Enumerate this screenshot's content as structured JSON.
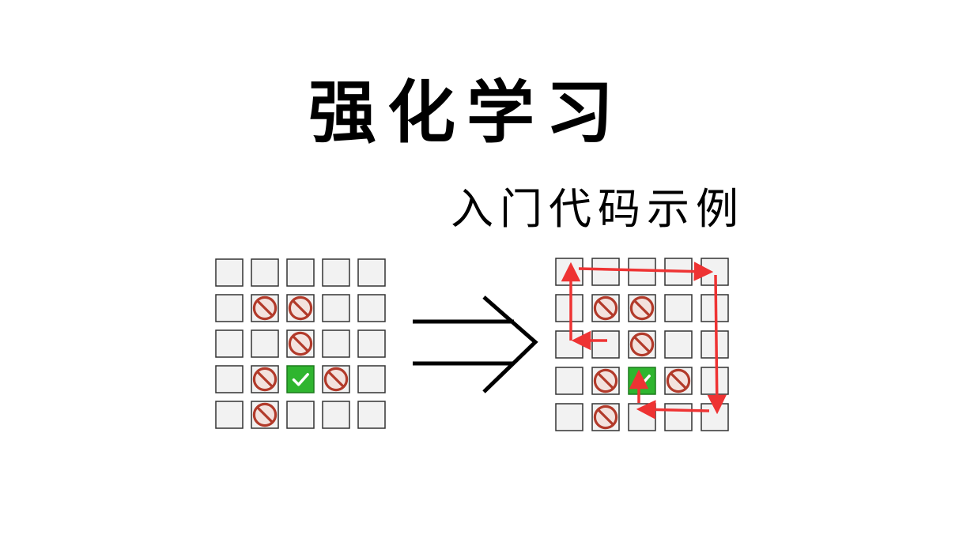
{
  "title": "强化学习",
  "subtitle": "入门代码示例",
  "grid": {
    "rows": 5,
    "cols": 5,
    "obstacles": [
      [
        1,
        1
      ],
      [
        1,
        2
      ],
      [
        2,
        2
      ],
      [
        3,
        1
      ],
      [
        3,
        3
      ],
      [
        4,
        1
      ]
    ],
    "goal": [
      3,
      2
    ]
  },
  "colors": {
    "cell_fill": "#f2f2f2",
    "cell_stroke": "#333333",
    "obstacle": "#b23a2a",
    "obstacle_fill": "#f3e2de",
    "goal": "#2fb52f",
    "path": "#ee3333",
    "arrow": "#000000"
  },
  "icons": {
    "obstacle": "no-entry-icon",
    "goal": "checkmark-icon",
    "transform": "implies-arrow-icon"
  }
}
